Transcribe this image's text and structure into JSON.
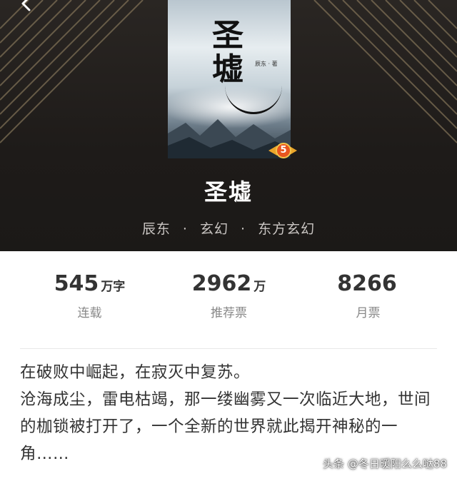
{
  "header": {
    "back_icon": "arrow-left-icon"
  },
  "book": {
    "cover_title_art": "圣墟",
    "cover_author_art": "辰东 · 著",
    "badge_value": "5",
    "title": "圣墟",
    "author": "辰东",
    "category": "玄幻",
    "subcategory": "东方玄幻",
    "separator": "·"
  },
  "stats": [
    {
      "value": "545",
      "unit": "万字",
      "label": "连载"
    },
    {
      "value": "2962",
      "unit": "万",
      "label": "推荐票"
    },
    {
      "value": "8266",
      "unit": "",
      "label": "月票"
    }
  ],
  "description": {
    "lines": [
      "在破败中崛起，在寂灭中复苏。",
      "沧海成尘，雷电枯竭，那一缕幽雾又一次临近大地，世间的枷锁被打开了，一个全新的世界就此揭开神秘的一角……"
    ]
  },
  "watermark": {
    "text": "头条 @冬日暖阳么么哒88"
  },
  "colors": {
    "hero_bg": "#1e1b19",
    "stripe": "#8a7a5a",
    "badge_orange": "#e8551f",
    "badge_gold": "#f4c44b"
  }
}
